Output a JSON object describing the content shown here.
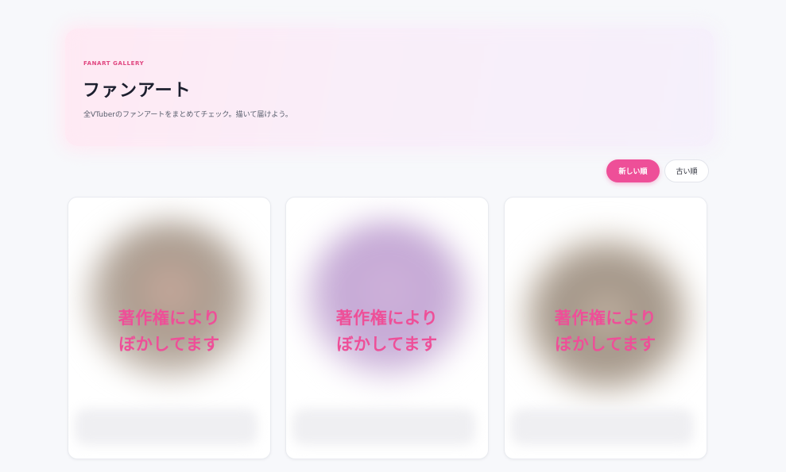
{
  "hero": {
    "eyebrow": "FANART GALLERY",
    "title": "ファンアート",
    "subtitle": "全VTuberのファンアートをまとめてチェック。描いて届けよう。"
  },
  "sort": {
    "newest_label": "新しい順",
    "oldest_label": "古い順",
    "active": "newest"
  },
  "cards": [
    {
      "notice_line1": "著作権により",
      "notice_line2": "ぼかしてます",
      "art_colors": [
        "#c7a69a",
        "#a8998c",
        "#d8cfc7"
      ]
    },
    {
      "notice_line1": "著作権により",
      "notice_line2": "ぼかしてます",
      "art_colors": [
        "#d2b6dc",
        "#c6a9d6",
        "#ebe0ef"
      ]
    },
    {
      "notice_line1": "著作権により",
      "notice_line2": "ぼかしてます",
      "art_colors": [
        "#b8aa9c",
        "#9c8f82",
        "#d9cfc3"
      ]
    }
  ],
  "colors": {
    "accent": "#ee4f98",
    "eyebrow": "#e0457f",
    "background": "#f7f8fb"
  }
}
